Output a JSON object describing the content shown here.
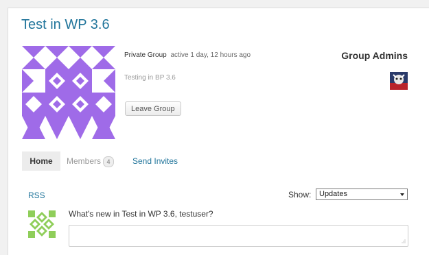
{
  "group": {
    "title": "Test in WP 3.6",
    "type": "Private Group",
    "activity": "active 1 day, 12 hours ago",
    "description": "Testing in BP 3.6",
    "leave_button": "Leave Group"
  },
  "admins": {
    "heading": "Group Admins"
  },
  "tabs": [
    {
      "label": "Home"
    },
    {
      "label": "Members",
      "count": "4"
    },
    {
      "label": "Send Invites"
    }
  ],
  "activity_filter": {
    "rss_label": "RSS",
    "show_label": "Show:",
    "selected": "Updates"
  },
  "post_form": {
    "prompt": "What's new in Test in WP 3.6, testuser?",
    "placeholder": ""
  },
  "colors": {
    "link": "#21759b",
    "group_avatar": "#9f6be8",
    "user_avatar": "#8fce5a"
  }
}
